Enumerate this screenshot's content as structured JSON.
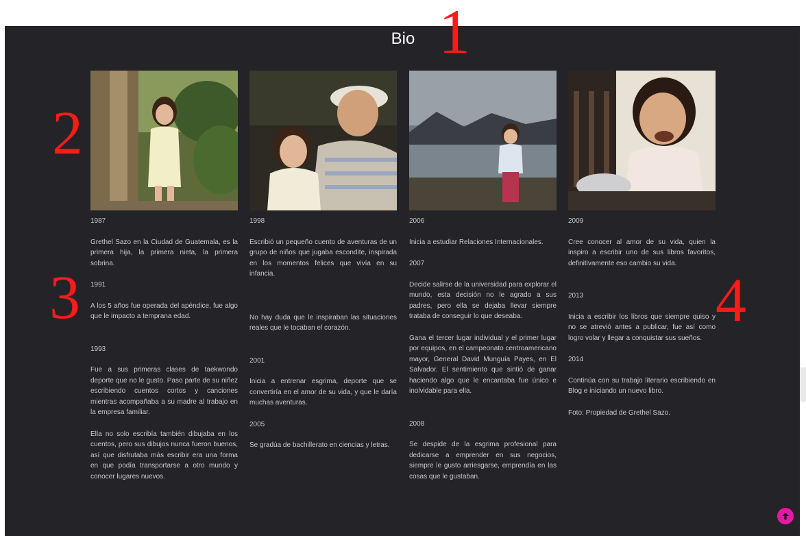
{
  "page": {
    "title": "Bio"
  },
  "annotations": [
    "1",
    "2",
    "3",
    "4"
  ],
  "columns": [
    {
      "photo_label": "girl-by-palm-tree-photo",
      "entries": [
        {
          "year": "1987",
          "paragraphs": [
            "Grethel Sazo en la Ciudad de Guatemala, es la primera hija, la primera nieta, la primera sobrina."
          ]
        },
        {
          "year": "1991",
          "paragraphs": [
            "A los 5 años fue operada del apéndice, fue algo que le impacto a temprana edad."
          ]
        },
        {
          "year": "1993",
          "paragraphs": [
            "Fue a sus primeras clases de taekwondo deporte que no le gusto. Paso parte de su niñez escribiendo cuentos cortos y canciones mientras acompañaba a su madre al trabajo en la empresa familiar.",
            "Ella no solo escribía también dibujaba en los cuentos, pero sus dibujos nunca fueron buenos, así que disfrutaba más escribir era una forma en que podía transportarse a otro mundo y conocer lugares nuevos."
          ]
        }
      ]
    },
    {
      "photo_label": "girl-with-father-photo",
      "entries": [
        {
          "year": "1998",
          "paragraphs": [
            "Escribió un pequeño cuento de aventuras de un grupo de niños que jugaba escondite, inspirada en los momentos felices que vivía en su infancia.",
            "No hay duda que le inspiraban las situaciones reales que le tocaban el corazón."
          ]
        },
        {
          "year": "2001",
          "paragraphs": [
            "Inicia a entrenar esgrima, deporte que se convertiría en el amor de su vida, y que le daría muchas aventuras."
          ]
        },
        {
          "year": "2005",
          "paragraphs": [
            "Se gradúa de bachillerato en ciencias y letras."
          ]
        }
      ]
    },
    {
      "photo_label": "girl-by-lake-photo",
      "entries": [
        {
          "year": "2006",
          "paragraphs": [
            "Inicia a estudiar Relaciones Internacionales."
          ]
        },
        {
          "year": "2007",
          "paragraphs": [
            "Decide salirse de la universidad para explorar el mundo, esta decisión no le agrado a sus padres, pero ella se dejaba llevar siempre trataba de conseguir lo que deseaba.",
            "Gana el tercer lugar individual y el primer lugar por equipos, en el campeonato centroamericano mayor, General David Munguía Payes, en El Salvador. El sentimiento que sintió de ganar haciendo algo que le encantaba fue único e inolvidable para ella."
          ]
        },
        {
          "year": "2008",
          "paragraphs": [
            "Se despide de la esgrima profesional para dedicarse a emprender en sus negocios, siempre le gusto arriesgarse, emprendía en las cosas que le gustaban."
          ]
        }
      ]
    },
    {
      "photo_label": "girl-in-high-chair-photo",
      "entries": [
        {
          "year": "2009",
          "paragraphs": [
            "Cree conocer al amor de su vida, quien la inspiro a escribir uno de sus libros favoritos, definitivamente eso cambio su vida."
          ]
        },
        {
          "year": "2013",
          "paragraphs": [
            "Inicia a escribir los libros que siempre quiso y no se atrevió antes a publicar, fue así como logro volar y llegar a conquistar sus sueños."
          ]
        },
        {
          "year": "2014",
          "paragraphs": [
            "Continúa con su trabajo literario escribiendo en Blog e iniciando un nuevo libro.",
            "Foto: Propiedad de Grethel Sazo."
          ]
        }
      ]
    }
  ],
  "scroll_top": {
    "icon": "arrow-up-icon",
    "color": "#e21aa6"
  },
  "colors": {
    "panel_bg": "#242428",
    "text": "#c9c9c9",
    "marker": "#ff1a1a"
  }
}
